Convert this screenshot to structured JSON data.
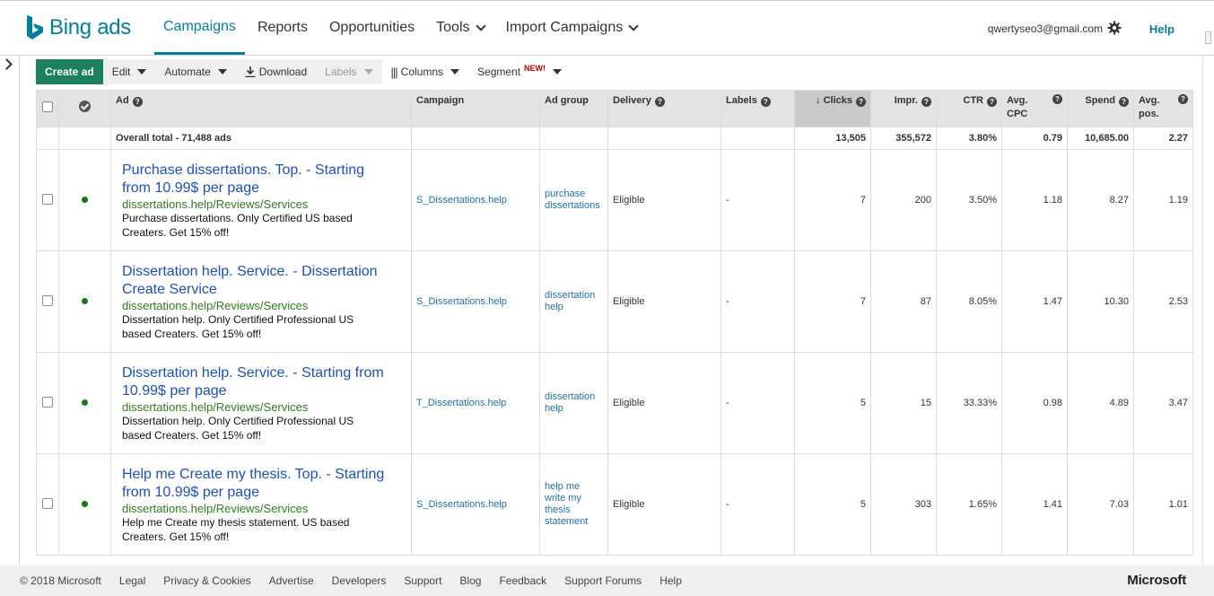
{
  "header": {
    "logo_text": "Bing ads",
    "nav": [
      {
        "label": "Campaigns",
        "active": true,
        "dropdown": false
      },
      {
        "label": "Reports",
        "active": false,
        "dropdown": false
      },
      {
        "label": "Opportunities",
        "active": false,
        "dropdown": false
      },
      {
        "label": "Tools",
        "active": false,
        "dropdown": true
      },
      {
        "label": "Import Campaigns",
        "active": false,
        "dropdown": true
      }
    ],
    "user_email": "qwertyseo3@gmail.com",
    "help_label": "Help"
  },
  "toolbar": {
    "create_label": "Create ad",
    "edit_label": "Edit",
    "automate_label": "Automate",
    "download_label": "Download",
    "labels_label": "Labels",
    "columns_label": "Columns",
    "segment_label": "Segment",
    "new_badge": "NEW!"
  },
  "table": {
    "headers": {
      "ad": "Ad",
      "campaign": "Campaign",
      "ad_group": "Ad group",
      "delivery": "Delivery",
      "labels": "Labels",
      "clicks": "Clicks",
      "impr": "Impr.",
      "ctr": "CTR",
      "avg_cpc_1": "Avg.",
      "avg_cpc_2": "CPC",
      "spend": "Spend",
      "avg_pos_1": "Avg.",
      "avg_pos_2": "pos."
    },
    "total": {
      "label": "Overall total - 71,488 ads",
      "clicks": "13,505",
      "impr": "355,572",
      "ctr": "3.80%",
      "avg_cpc": "0.79",
      "spend": "10,685.00",
      "avg_pos": "2.27"
    },
    "rows": [
      {
        "title_1": "Purchase dissertations. Top. - Starting",
        "title_2": "from 10.99$ per page",
        "url": "dissertations.help/Reviews/Services",
        "desc_1": "Purchase dissertations. Only Certified US based",
        "desc_2": "Creaters. Get 15% off!",
        "campaign": "S_Dissertations.help",
        "ad_group": [
          "purchase",
          "dissertations"
        ],
        "delivery": "Eligible",
        "labels": "-",
        "clicks": "7",
        "impr": "200",
        "ctr": "3.50%",
        "avg_cpc": "1.18",
        "spend": "8.27",
        "avg_pos": "1.19"
      },
      {
        "title_1": "Dissertation help. Service. - Dissertation",
        "title_2": "Create Service",
        "url": "dissertations.help/Reviews/Services",
        "desc_1": "Dissertation help. Only Certified Professional US",
        "desc_2": "based Creaters. Get 15% off!",
        "campaign": "S_Dissertations.help",
        "ad_group": [
          "dissertation",
          "help"
        ],
        "delivery": "Eligible",
        "labels": "-",
        "clicks": "7",
        "impr": "87",
        "ctr": "8.05%",
        "avg_cpc": "1.47",
        "spend": "10.30",
        "avg_pos": "2.53"
      },
      {
        "title_1": "Dissertation help. Service. - Starting from",
        "title_2": "10.99$ per page",
        "url": "dissertations.help/Reviews/Services",
        "desc_1": "Dissertation help. Only Certified Professional US",
        "desc_2": "based Creaters. Get 15% off!",
        "campaign": "T_Dissertations.help",
        "ad_group": [
          "dissertation",
          "help"
        ],
        "delivery": "Eligible",
        "labels": "-",
        "clicks": "5",
        "impr": "15",
        "ctr": "33.33%",
        "avg_cpc": "0.98",
        "spend": "4.89",
        "avg_pos": "3.47"
      },
      {
        "title_1": "Help me Create my thesis. Top. - Starting",
        "title_2": "from 10.99$ per page",
        "url": "dissertations.help/Reviews/Services",
        "desc_1": "Help me Create my thesis statement. US based",
        "desc_2": "Creaters. Get 15% off!",
        "campaign": "S_Dissertations.help",
        "ad_group": [
          "help me",
          "write my",
          "thesis",
          "statement"
        ],
        "delivery": "Eligible",
        "labels": "-",
        "clicks": "5",
        "impr": "303",
        "ctr": "1.65%",
        "avg_cpc": "1.41",
        "spend": "7.03",
        "avg_pos": "1.01"
      }
    ]
  },
  "footer": {
    "links": [
      "© 2018 Microsoft",
      "Legal",
      "Privacy & Cookies",
      "Advertise",
      "Developers",
      "Support",
      "Blog",
      "Feedback",
      "Support Forums",
      "Help"
    ],
    "brand": "Microsoft"
  },
  "colors": {
    "brand_teal": "#00809d",
    "create_green": "#1b7f60",
    "ad_title_blue": "#1a4ed1",
    "ad_url_green": "#2e7d1f",
    "status_green": "#107c10"
  }
}
